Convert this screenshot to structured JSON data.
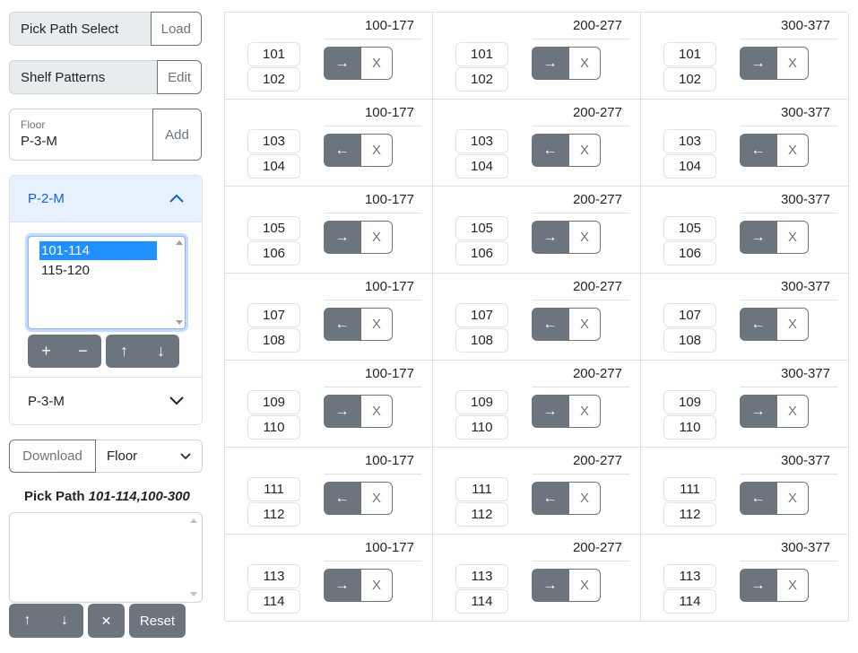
{
  "left": {
    "pick_select": {
      "label": "Pick Path Select",
      "button": "Load"
    },
    "shelf_patterns": {
      "label": "Shelf Patterns",
      "button": "Edit"
    },
    "floor": {
      "label": "Floor",
      "value": "P-3-M",
      "button": "Add"
    },
    "accordion": [
      {
        "title": "P-2-M",
        "expanded": true,
        "options": [
          "101-114",
          "115-120"
        ],
        "selected": "101-114",
        "buttons": [
          "+",
          "−",
          "↑",
          "↓"
        ]
      },
      {
        "title": "P-3-M",
        "expanded": false
      }
    ],
    "download": {
      "button": "Download",
      "select_value": "Floor"
    },
    "pick_path": {
      "label": "Pick Path",
      "value": "101-114,100-300",
      "text": ""
    },
    "bottom_buttons": [
      "↑",
      "↓",
      "✕",
      "Reset"
    ]
  },
  "grid": {
    "columns": [
      "100-177",
      "200-277",
      "300-377"
    ],
    "rows": [
      {
        "shelves": [
          "101",
          "102"
        ],
        "direction": "→"
      },
      {
        "shelves": [
          "103",
          "104"
        ],
        "direction": "←"
      },
      {
        "shelves": [
          "105",
          "106"
        ],
        "direction": "→"
      },
      {
        "shelves": [
          "107",
          "108"
        ],
        "direction": "←"
      },
      {
        "shelves": [
          "109",
          "110"
        ],
        "direction": "→"
      },
      {
        "shelves": [
          "111",
          "112"
        ],
        "direction": "←"
      },
      {
        "shelves": [
          "113",
          "114"
        ],
        "direction": "→"
      }
    ],
    "remove_label": "X"
  },
  "colors": {
    "secondary": "#6c757d",
    "primary_text": "#0c63e4",
    "accordion_active_bg": "#e7f1ff",
    "selected_option": "#1e90ff",
    "border": "#dee2e6"
  },
  "icons": {
    "accordion_open": "chevron-up-icon",
    "accordion_closed": "chevron-down-icon",
    "select": "chevron-down-icon"
  }
}
